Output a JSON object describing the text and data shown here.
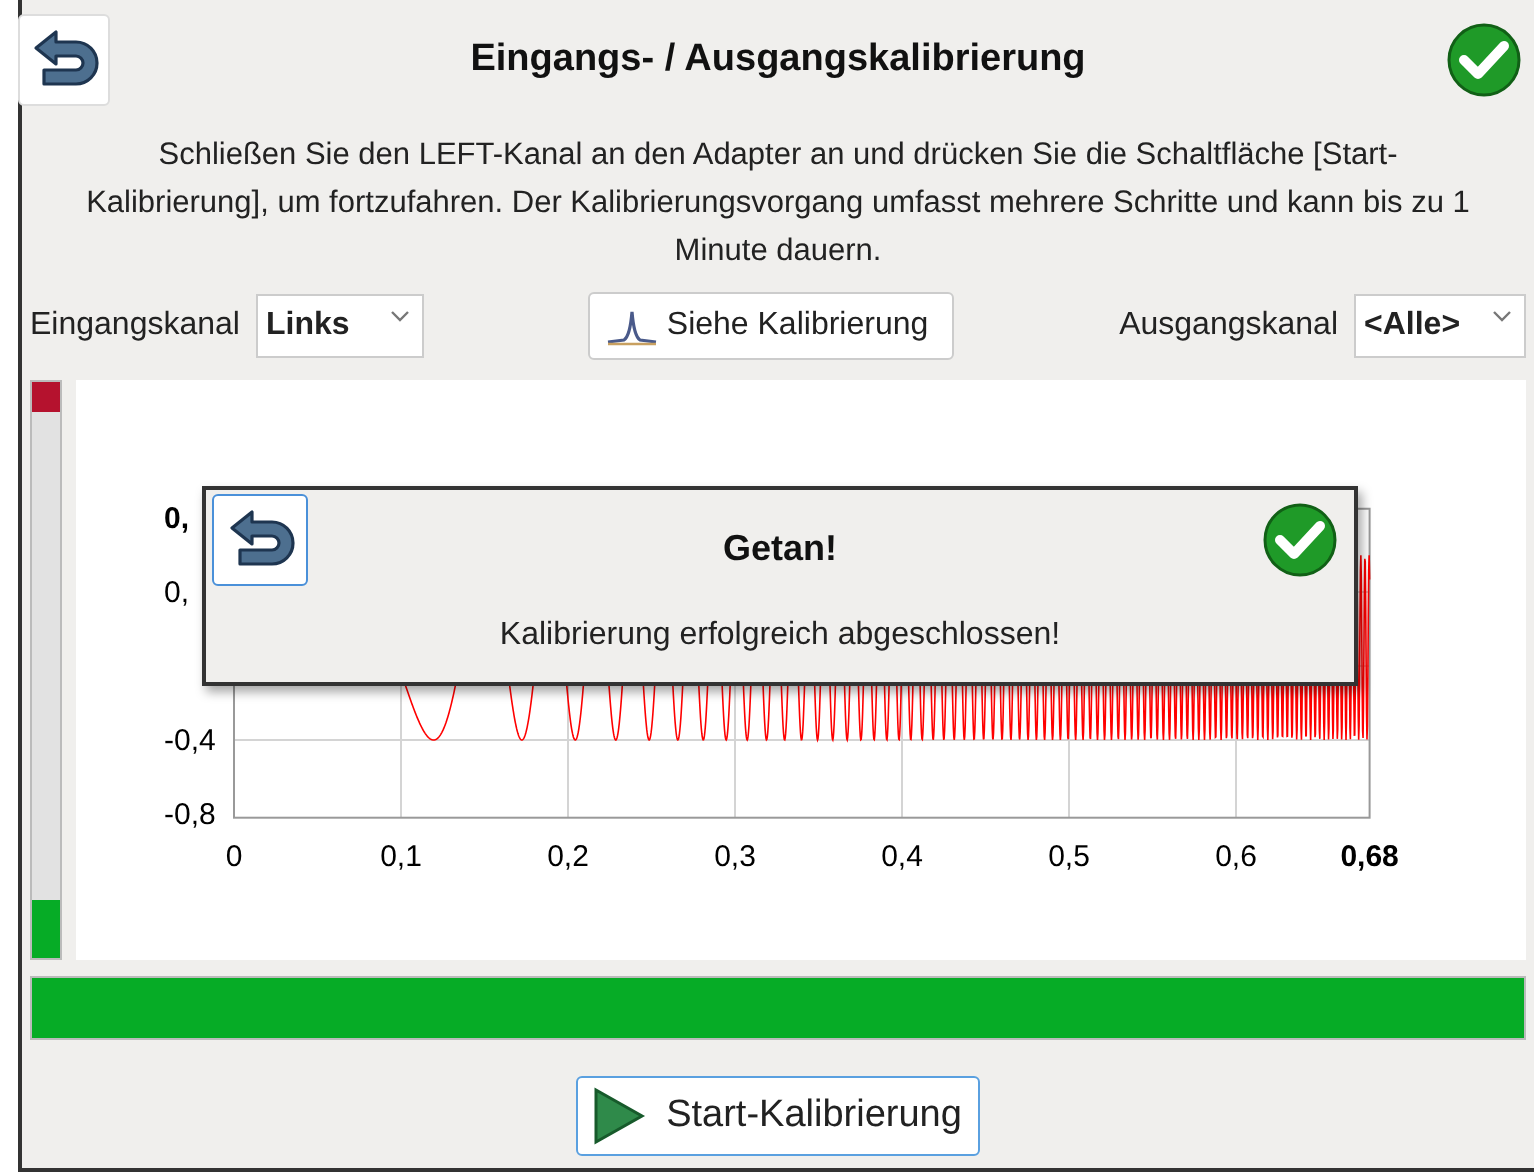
{
  "dialog": {
    "title": "Eingangs- / Ausgangskalibrierung",
    "instructions": "Schließen Sie den LEFT-Kanal an den Adapter an und drücken Sie die Schaltfläche [Start-Kalibrierung], um fortzufahren. Der Kalibrierungsvorgang umfasst mehrere Schritte und kann bis zu 1 Minute dauern."
  },
  "input_channel": {
    "label": "Eingangskanal",
    "value": "Links"
  },
  "view_button": {
    "label": "Siehe Kalibrierung"
  },
  "output_channel": {
    "label": "Ausgangskanal",
    "value": "<Alle>"
  },
  "level_meter": {
    "level": 0.1,
    "clipped": true
  },
  "chart": {
    "y_end": "0,",
    "y_ticks": [
      "0,",
      "-0,4",
      "-0,8"
    ],
    "x_ticks": [
      "0",
      "0,1",
      "0,2",
      "0,3",
      "0,4",
      "0,5",
      "0,6"
    ],
    "x_end": "0,68"
  },
  "popup": {
    "title": "Getan!",
    "message": "Kalibrierung erfolgreich abgeschlossen!"
  },
  "progress": {
    "level": 1
  },
  "start_button": {
    "label": "Start-Kalibrierung"
  }
}
